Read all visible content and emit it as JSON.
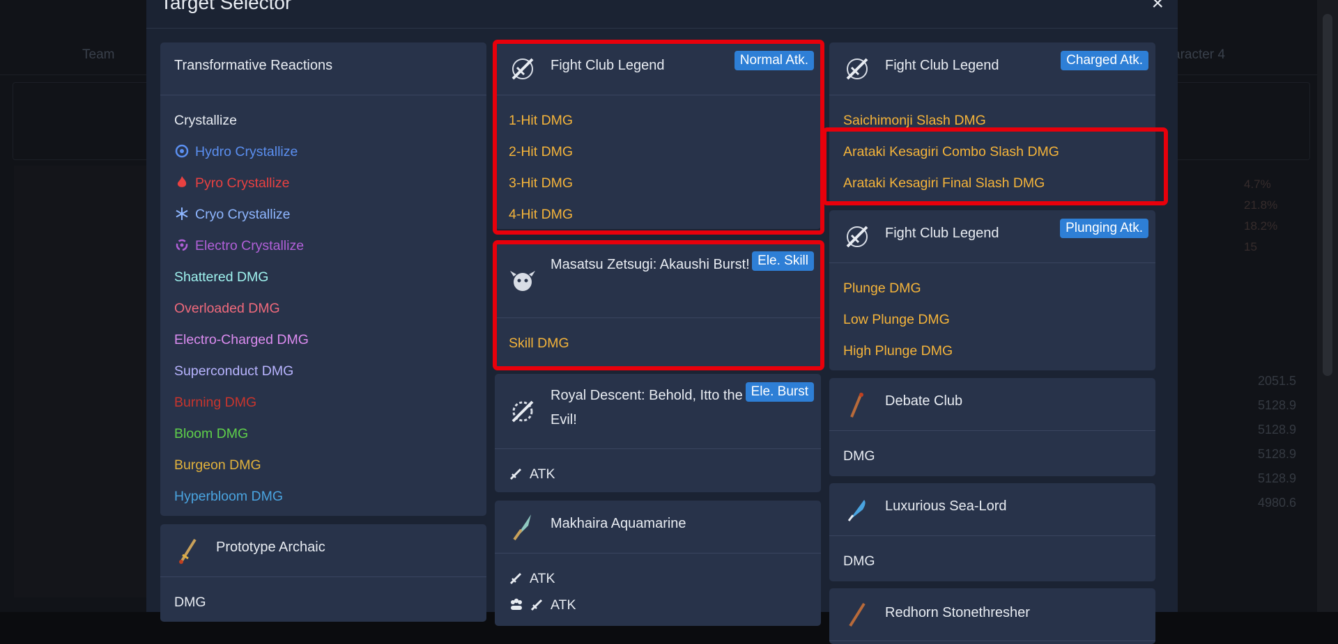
{
  "background": {
    "team_label": "Team",
    "character_label": "aracter 4",
    "right_values": [
      "2051.5",
      "5128.9",
      "5128.9",
      "5128.9",
      "5128.9",
      "4980.6"
    ],
    "stats": [
      "4.7%",
      "21.8%",
      "18.2%",
      "15"
    ]
  },
  "modal": {
    "title": "Target Selector",
    "close_label": "×"
  },
  "reactions": {
    "title": "Transformative Reactions",
    "crystallize_heading": "Crystallize",
    "crystallize": [
      {
        "label": "Hydro Crystallize",
        "color": "#5b8ff0",
        "icon": "hydro-icon"
      },
      {
        "label": "Pyro Crystallize",
        "color": "#e84141",
        "icon": "pyro-icon"
      },
      {
        "label": "Cryo Crystallize",
        "color": "#8eb6ff",
        "icon": "cryo-icon"
      },
      {
        "label": "Electro Crystallize",
        "color": "#b160d8",
        "icon": "electro-icon"
      }
    ],
    "others": [
      {
        "label": "Shattered DMG",
        "color": "#9ff3ef"
      },
      {
        "label": "Overloaded DMG",
        "color": "#f06a7c"
      },
      {
        "label": "Electro-Charged DMG",
        "color": "#dc8cf0"
      },
      {
        "label": "Superconduct DMG",
        "color": "#b8b4ff"
      },
      {
        "label": "Burning DMG",
        "color": "#c8352d"
      },
      {
        "label": "Bloom DMG",
        "color": "#5fd04a"
      },
      {
        "label": "Burgeon DMG",
        "color": "#e2b23c"
      },
      {
        "label": "Hyperbloom DMG",
        "color": "#4aa4e0"
      }
    ]
  },
  "prototype": {
    "name": "Prototype Archaic",
    "items": [
      "DMG"
    ]
  },
  "normal": {
    "name": "Fight Club Legend",
    "badge": "Normal Atk.",
    "items": [
      "1-Hit DMG",
      "2-Hit DMG",
      "3-Hit DMG",
      "4-Hit DMG"
    ]
  },
  "skill": {
    "name": "Masatsu Zetsugi: Akaushi Burst!",
    "badge": "Ele. Skill",
    "items": [
      "Skill DMG"
    ]
  },
  "burst": {
    "name": "Royal Descent: Behold, Itto the Evil!",
    "badge": "Ele. Burst",
    "items": [
      "ATK"
    ]
  },
  "makhaira": {
    "name": "Makhaira Aquamarine",
    "items": [
      "ATK",
      "ATK"
    ]
  },
  "charged": {
    "name": "Fight Club Legend",
    "badge": "Charged Atk.",
    "items": [
      "Saichimonji Slash DMG",
      "Arataki Kesagiri Combo Slash DMG",
      "Arataki Kesagiri Final Slash DMG"
    ]
  },
  "plunging": {
    "name": "Fight Club Legend",
    "badge": "Plunging Atk.",
    "items": [
      "Plunge DMG",
      "Low Plunge DMG",
      "High Plunge DMG"
    ]
  },
  "debate": {
    "name": "Debate Club",
    "items": [
      "DMG"
    ]
  },
  "sealord": {
    "name": "Luxurious Sea-Lord",
    "items": [
      "DMG"
    ]
  },
  "redhorn": {
    "name": "Redhorn Stonethresher"
  }
}
